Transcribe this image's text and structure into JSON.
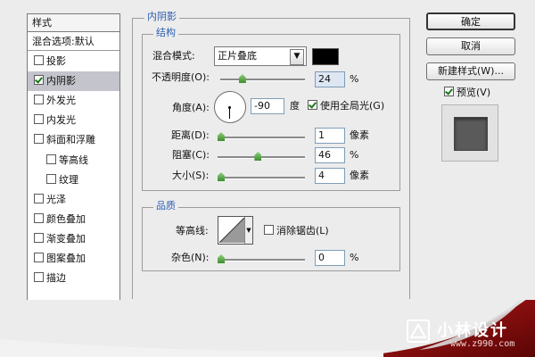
{
  "styles_panel": {
    "header": "样式",
    "blend_options": "混合选项:默认",
    "items": [
      {
        "label": "投影",
        "checked": false,
        "indent": false,
        "selected": false
      },
      {
        "label": "内阴影",
        "checked": true,
        "indent": false,
        "selected": true
      },
      {
        "label": "外发光",
        "checked": false,
        "indent": false,
        "selected": false
      },
      {
        "label": "内发光",
        "checked": false,
        "indent": false,
        "selected": false
      },
      {
        "label": "斜面和浮雕",
        "checked": false,
        "indent": false,
        "selected": false
      },
      {
        "label": "等高线",
        "checked": false,
        "indent": true,
        "selected": false
      },
      {
        "label": "纹理",
        "checked": false,
        "indent": true,
        "selected": false
      },
      {
        "label": "光泽",
        "checked": false,
        "indent": false,
        "selected": false
      },
      {
        "label": "颜色叠加",
        "checked": false,
        "indent": false,
        "selected": false
      },
      {
        "label": "渐变叠加",
        "checked": false,
        "indent": false,
        "selected": false
      },
      {
        "label": "图案叠加",
        "checked": false,
        "indent": false,
        "selected": false
      },
      {
        "label": "描边",
        "checked": false,
        "indent": false,
        "selected": false
      }
    ]
  },
  "inner_shadow": {
    "title": "内阴影",
    "structure": {
      "title": "结构",
      "blend_mode_label": "混合模式:",
      "blend_mode_value": "正片叠底",
      "shadow_color": "#000000",
      "opacity_label": "不透明度(O):",
      "opacity_value": "24",
      "opacity_unit": "%",
      "opacity_percent": 24,
      "angle_label": "角度(A):",
      "angle_value": "-90",
      "angle_unit": "度",
      "angle_degrees": -90,
      "global_light_label": "使用全局光(G)",
      "global_light_checked": true,
      "distance_label": "距离(D):",
      "distance_value": "1",
      "distance_unit": "像素",
      "distance_fraction": 0.0,
      "choke_label": "阻塞(C):",
      "choke_value": "46",
      "choke_unit": "%",
      "choke_fraction": 0.46,
      "size_label": "大小(S):",
      "size_value": "4",
      "size_unit": "像素",
      "size_fraction": 0.0
    },
    "quality": {
      "title": "品质",
      "contour_label": "等高线:",
      "anti_alias_label": "消除锯齿(L)",
      "anti_alias_checked": false,
      "noise_label": "杂色(N):",
      "noise_value": "0",
      "noise_unit": "%",
      "noise_fraction": 0.0
    }
  },
  "actions": {
    "ok": "确定",
    "cancel": "取消",
    "new_style": "新建样式(W)...",
    "preview_label": "预览(V)",
    "preview_checked": true
  },
  "watermark": {
    "name": "小林设计",
    "url": "www.z990.com"
  },
  "colors": {
    "accent_title": "#2e5fb0",
    "banner_red": "#8c0b0b"
  }
}
